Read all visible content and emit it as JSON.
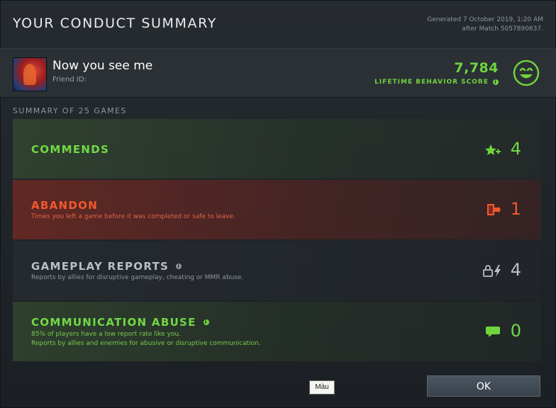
{
  "dialog": {
    "title": "YOUR CONDUCT SUMMARY",
    "generated_line1": "Generated 7 October 2019, 1:20 AM",
    "generated_line2": "after Match 5057890637."
  },
  "player": {
    "name": "Now you see me",
    "friend_id_label": "Friend ID:",
    "score": "7,784",
    "score_label": "LIFETIME BEHAVIOR SCORE",
    "info_icon": "i"
  },
  "summary": {
    "label": "SUMMARY OF 25 GAMES"
  },
  "cards": {
    "commends": {
      "title": "COMMENDS",
      "count": "4",
      "icon": "star-plus-icon"
    },
    "abandon": {
      "title": "ABANDON",
      "desc": "Times you left a game before it was completed or safe to leave.",
      "count": "1",
      "icon": "door-exit-icon"
    },
    "gameplay": {
      "title": "GAMEPLAY REPORTS",
      "desc": "Reports by allies for disruptive gameplay, cheating or MMR abuse.",
      "count": "4",
      "icon": "lock-bolt-icon"
    },
    "communication": {
      "title": "COMMUNICATION ABUSE",
      "desc1": "85% of players have a low report rate like you.",
      "desc2": "Reports by allies and enemies for abusive or disruptive communication.",
      "count": "0",
      "icon": "chat-bubble-icon"
    }
  },
  "footer": {
    "tooltip": "Màu",
    "ok_label": "OK"
  },
  "colors": {
    "positive": "#72d845",
    "negative": "#f2582f",
    "neutral": "#b9bfc3"
  }
}
